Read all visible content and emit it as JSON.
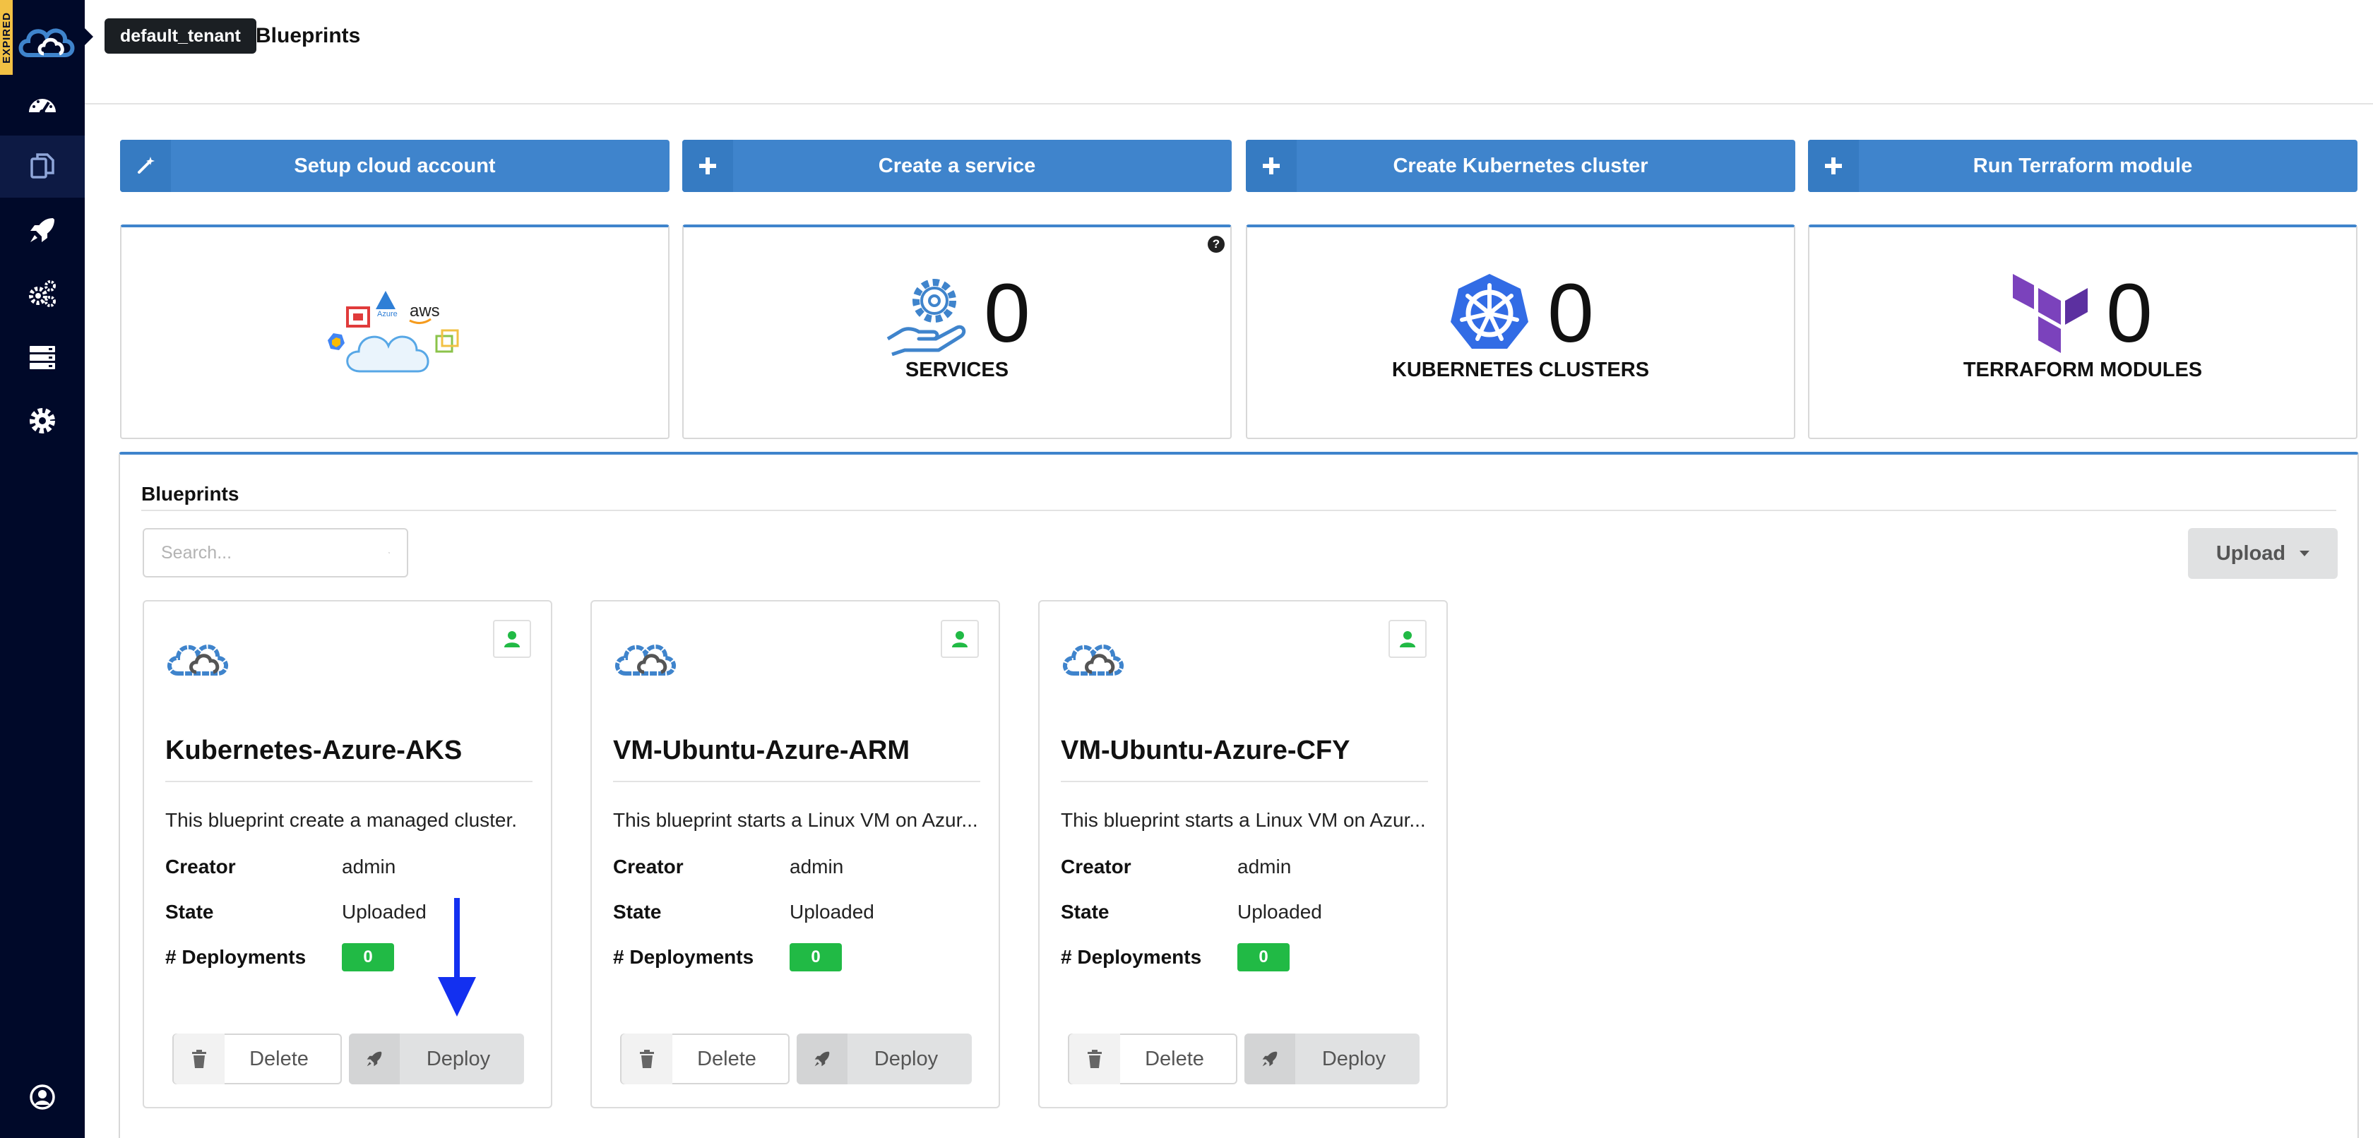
{
  "sidebar": {
    "expired_label": "EXPIRED",
    "items": [
      {
        "name": "dashboard",
        "icon": "gauge-icon"
      },
      {
        "name": "blueprints",
        "icon": "copy-icon",
        "active": true
      },
      {
        "name": "deployments",
        "icon": "rocket-icon"
      },
      {
        "name": "services",
        "icon": "gears-icon"
      },
      {
        "name": "resources",
        "icon": "server-icon"
      },
      {
        "name": "settings",
        "icon": "gear-icon"
      }
    ],
    "footer_icon": "user-circle-icon"
  },
  "header": {
    "tenant": "default_tenant",
    "breadcrumb": "Blueprints"
  },
  "actions": [
    {
      "label": "Setup cloud account",
      "icon": "magic-wand-icon"
    },
    {
      "label": "Create a service",
      "icon": "plus-icon"
    },
    {
      "label": "Create Kubernetes cluster",
      "icon": "plus-icon"
    },
    {
      "label": "Run Terraform module",
      "icon": "plus-icon"
    }
  ],
  "stats": {
    "cloud_text": "aws",
    "cloud_azure": "Azure",
    "services": {
      "value": "0",
      "label": "SERVICES",
      "help": "?"
    },
    "kubernetes": {
      "value": "0",
      "label": "KUBERNETES CLUSTERS"
    },
    "terraform": {
      "value": "0",
      "label": "TERRAFORM MODULES"
    }
  },
  "blueprints": {
    "title": "Blueprints",
    "search_placeholder": "Search...",
    "upload_label": "Upload",
    "labels": {
      "creator": "Creator",
      "state": "State",
      "deployments": "# Deployments",
      "delete": "Delete",
      "deploy": "Deploy"
    },
    "items": [
      {
        "name": "Kubernetes-Azure-AKS",
        "description": "This blueprint create a managed cluster.",
        "creator": "admin",
        "state": "Uploaded",
        "deployments": "0"
      },
      {
        "name": "VM-Ubuntu-Azure-ARM",
        "description": "This blueprint starts a Linux VM on Azur...",
        "creator": "admin",
        "state": "Uploaded",
        "deployments": "0"
      },
      {
        "name": "VM-Ubuntu-Azure-CFY",
        "description": "This blueprint starts a Linux VM on Azur...",
        "creator": "admin",
        "state": "Uploaded",
        "deployments": "0"
      }
    ]
  },
  "colors": {
    "sidebar_bg": "#000929",
    "accent_blue": "#3f84cc",
    "badge_green": "#21ba45",
    "expired_yellow": "#f2c144",
    "kubernetes_blue": "#326ce5",
    "terraform_purple": "#7b42bc"
  }
}
